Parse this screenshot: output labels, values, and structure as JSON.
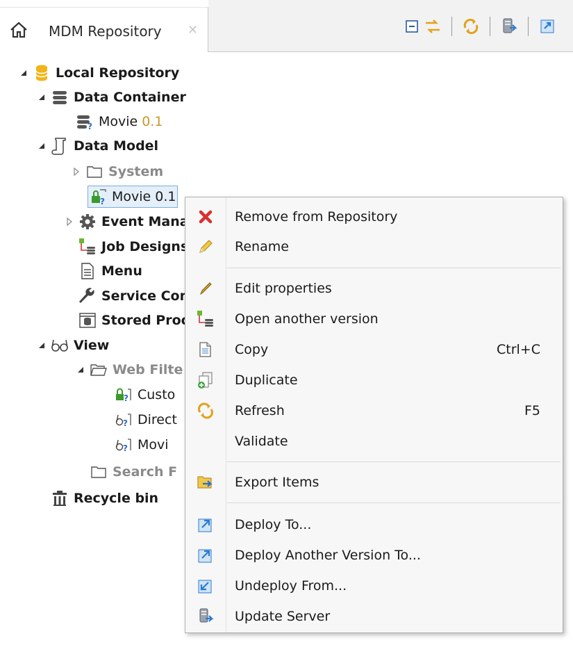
{
  "tab": {
    "title": "MDM Repository",
    "close": "✕"
  },
  "toolbar": {
    "icons": [
      "collapse-all-icon",
      "link-with-editor-icon",
      "refresh-icon",
      "import-server-icon",
      "deploy-icon"
    ]
  },
  "tree": {
    "local_repository": "Local Repository",
    "data_container": "Data Container",
    "data_container_movie": {
      "name": "Movie",
      "version": "0.1"
    },
    "data_model": "Data Model",
    "system": "System",
    "data_model_movie": {
      "name": "Movie",
      "version": "0.1"
    },
    "event_manager": "Event Mana",
    "job_designs": "Job Designs",
    "menu": "Menu",
    "service_config": "Service Con",
    "stored_procedures": "Stored Proc",
    "view": "View",
    "web_filters": "Web Filte",
    "view_customer": "Custo",
    "view_director": "Direct",
    "view_movie": "Movi",
    "search_filters": "Search F",
    "recycle_bin": "Recycle bin"
  },
  "context_menu": {
    "remove": "Remove from Repository",
    "rename": "Rename",
    "edit_properties": "Edit properties",
    "open_another_version": "Open another version",
    "copy": "Copy",
    "copy_shortcut": "Ctrl+C",
    "duplicate": "Duplicate",
    "refresh": "Refresh",
    "refresh_shortcut": "F5",
    "validate": "Validate",
    "export_items": "Export Items",
    "deploy_to": "Deploy To...",
    "deploy_another_version": "Deploy Another Version To...",
    "undeploy_from": "Undeploy From...",
    "update_server": "Update Server"
  },
  "colors": {
    "selection_border": "#7aaede",
    "version_text": "#c49a2a",
    "menu_bg": "#f7f7f7"
  }
}
